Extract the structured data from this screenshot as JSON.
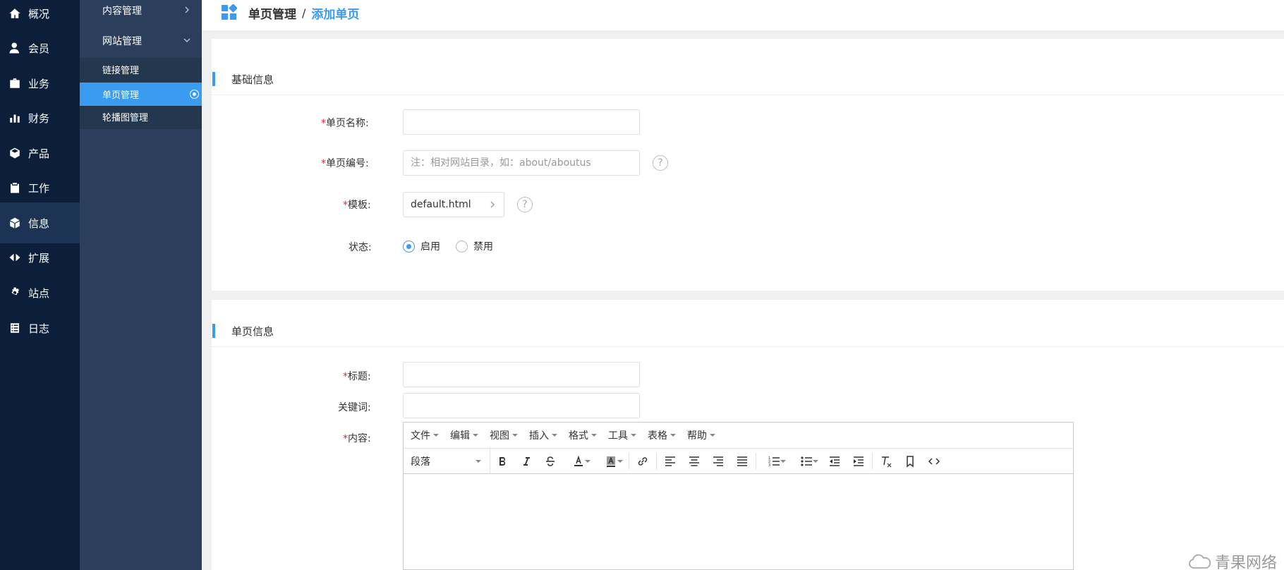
{
  "nav": {
    "items": [
      {
        "label": "概况",
        "icon": "home-icon"
      },
      {
        "label": "会员",
        "icon": "user-icon"
      },
      {
        "label": "业务",
        "icon": "briefcase-icon"
      },
      {
        "label": "财务",
        "icon": "bar-chart-icon"
      },
      {
        "label": "产品",
        "icon": "box-icon"
      },
      {
        "label": "工作",
        "icon": "clipboard-icon"
      },
      {
        "label": "信息",
        "icon": "cube-icon",
        "active": true
      },
      {
        "label": "扩展",
        "icon": "expand-icon"
      },
      {
        "label": "站点",
        "icon": "gear-icon"
      },
      {
        "label": "日志",
        "icon": "log-icon"
      }
    ]
  },
  "subnav": {
    "group_content": "内容管理",
    "group_site": "网站管理",
    "items": [
      "链接管理",
      "单页管理",
      "轮播图管理"
    ]
  },
  "header": {
    "title": "单页管理",
    "separator": "/",
    "current": "添加单页"
  },
  "basic": {
    "section_title": "基础信息",
    "name_label": "单页名称:",
    "code_label": "单页编号:",
    "code_placeholder": "注：相对网站目录，如：about/aboutus",
    "template_label": "模板:",
    "template_value": "default.html",
    "status_label": "状态:",
    "status_on": "启用",
    "status_off": "禁用",
    "required_mark": "*",
    "help_mark": "?"
  },
  "page": {
    "section_title": "单页信息",
    "title_label": "标题:",
    "keywords_label": "关键词:",
    "content_label": "内容:"
  },
  "editor": {
    "menus": [
      "文件",
      "编辑",
      "视图",
      "插入",
      "格式",
      "工具",
      "表格",
      "帮助"
    ],
    "format_select": "段落"
  },
  "watermark": "青果网络",
  "colors": {
    "accent": "#3a9bf0",
    "nav_bg": "#0c1f3a",
    "subnav_bg": "#2b3f5c"
  }
}
